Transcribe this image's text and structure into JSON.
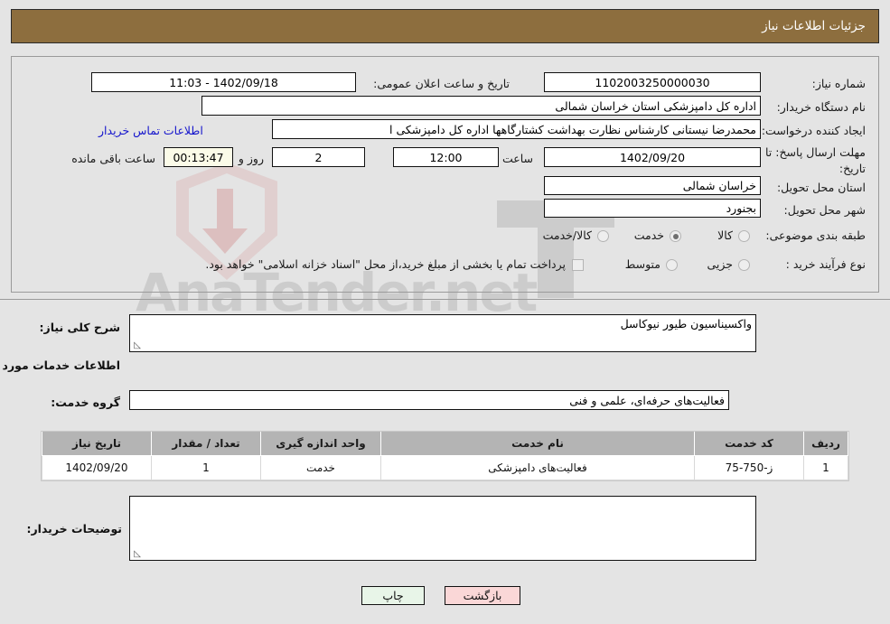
{
  "header": {
    "title": "جزئیات اطلاعات نیاز"
  },
  "form": {
    "need_number_label": "شماره نیاز:",
    "need_number_value": "1102003250000030",
    "public_announce_label": "تاریخ و ساعت اعلان عمومی:",
    "public_announce_value": "1402/09/18 - 11:03",
    "buyer_org_label": "نام دستگاه خریدار:",
    "buyer_org_value": "اداره کل دامپزشکی استان خراسان شمالی",
    "creator_label": "ایجاد کننده درخواست:",
    "creator_value": "محمدرضا نیستانی کارشناس نظارت بهداشت کشتارگاهها اداره کل دامپزشکی ا",
    "contact_link": "اطلاعات تماس خریدار",
    "deadline_label_line1": "مهلت ارسال پاسخ: تا",
    "deadline_label_line2": "تاریخ:",
    "deadline_date_value": "1402/09/20",
    "hour_label": "ساعت",
    "hour_value": "12:00",
    "days_value": "2",
    "days_label": "روز و",
    "countdown_value": "00:13:47",
    "countdown_label": "ساعت باقی مانده",
    "province_label": "استان محل تحویل:",
    "province_value": "خراسان شمالی",
    "city_label": "شهر محل تحویل:",
    "city_value": "بجنورد",
    "category_label": "طبقه بندی موضوعی:",
    "category_options": [
      "کالا",
      "خدمت",
      "کالا/خدمت"
    ],
    "category_selected": "خدمت",
    "process_label": "نوع فرآیند خرید :",
    "process_options": [
      "جزیی",
      "متوسط"
    ],
    "process_selected": "",
    "payment_note": "پرداخت تمام یا بخشی از مبلغ خرید،از محل \"اسناد خزانه اسلامی\" خواهد بود.",
    "payment_checked": false
  },
  "middle": {
    "need_desc_label": "شرح کلی نیاز:",
    "need_desc_value": "واکسیناسیون  طیور نیوکاسل",
    "services_info_title": "اطلاعات خدمات مورد نیاز",
    "service_group_label": "گروه خدمت:",
    "service_group_value": "فعالیت‌های حرفه‌ای، علمی و فنی"
  },
  "table": {
    "columns": [
      "ردیف",
      "کد خدمت",
      "نام خدمت",
      "واحد اندازه گیری",
      "تعداد / مقدار",
      "تاریخ نیاز"
    ],
    "rows": [
      {
        "row": "1",
        "code": "ز-750-75",
        "name": "فعالیت‌های دامپزشکی",
        "unit": "خدمت",
        "qty": "1",
        "date": "1402/09/20"
      }
    ]
  },
  "notes": {
    "label": "توضیحات خریدار:",
    "value": ""
  },
  "footer": {
    "print_label": "چاپ",
    "back_label": "بازگشت"
  },
  "watermark": {
    "text": "AnaTender.net"
  },
  "colors": {
    "header_brown": "#8d6e3e",
    "link_blue": "#1414cc",
    "table_header_gray": "#b4b4b4",
    "print_green": "#e8f5e8",
    "back_pink": "#fad7d7",
    "cream_field": "#fbfbe8",
    "page_bg": "#e4e4e4"
  }
}
